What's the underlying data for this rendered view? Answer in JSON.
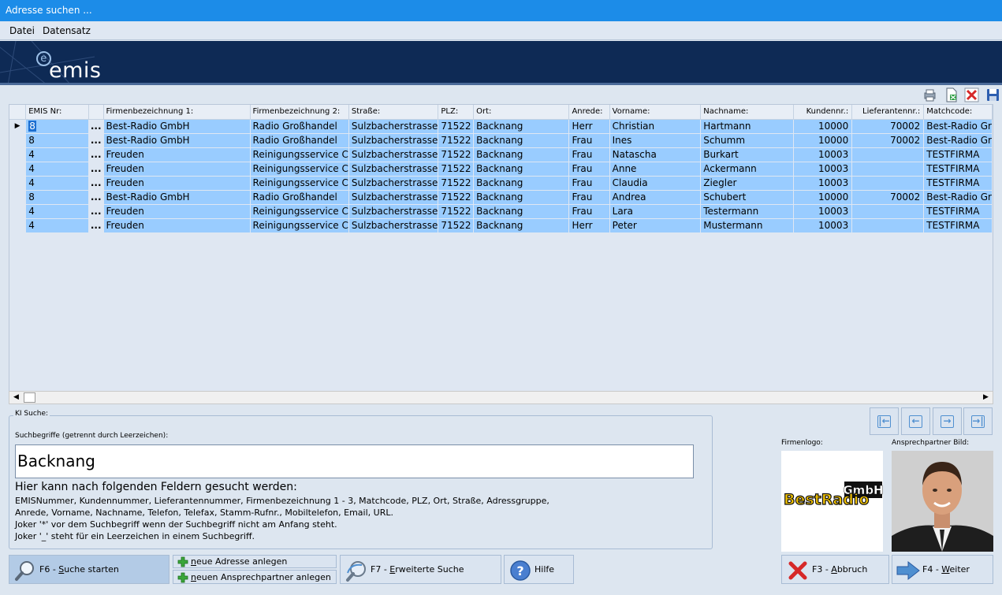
{
  "window": {
    "title": "Adresse suchen ..."
  },
  "menu": {
    "items": [
      "Datei",
      "Datensatz"
    ]
  },
  "brand": {
    "logo_text": "emis"
  },
  "toolbar": {
    "icons": [
      "print-icon",
      "export-icon",
      "delete-icon",
      "save-icon"
    ]
  },
  "grid": {
    "columns": [
      "EMIS Nr:",
      "",
      "Firmenbezeichnung 1:",
      "Firmenbezeichnung 2:",
      "Straße:",
      "PLZ:",
      "Ort:",
      "Anrede:",
      "Vorname:",
      "Nachname:",
      "Kundennr.:",
      "Lieferantennr.:",
      "Matchcode:"
    ],
    "rows": [
      [
        "8",
        "...",
        "Best-Radio GmbH",
        "Radio Großhandel",
        "Sulzbacherstrasse",
        "71522",
        "Backnang",
        "Herr",
        "Christian",
        "Hartmann",
        "10000",
        "70002",
        "Best-Radio Gr"
      ],
      [
        "8",
        "...",
        "Best-Radio GmbH",
        "Radio Großhandel",
        "Sulzbacherstrasse",
        "71522",
        "Backnang",
        "Frau",
        "Ines",
        "Schumm",
        "10000",
        "70002",
        "Best-Radio Gr"
      ],
      [
        "4",
        "...",
        "Freuden",
        "Reinigungsservice C",
        "Sulzbacherstrasse",
        "71522",
        "Backnang",
        "Frau",
        "Natascha",
        "Burkart",
        "10003",
        "",
        "TESTFIRMA"
      ],
      [
        "4",
        "...",
        "Freuden",
        "Reinigungsservice C",
        "Sulzbacherstrasse",
        "71522",
        "Backnang",
        "Frau",
        "Anne",
        "Ackermann",
        "10003",
        "",
        "TESTFIRMA"
      ],
      [
        "4",
        "...",
        "Freuden",
        "Reinigungsservice C",
        "Sulzbacherstrasse",
        "71522",
        "Backnang",
        "Frau",
        "Claudia",
        "Ziegler",
        "10003",
        "",
        "TESTFIRMA"
      ],
      [
        "8",
        "...",
        "Best-Radio GmbH",
        "Radio Großhandel",
        "Sulzbacherstrasse",
        "71522",
        "Backnang",
        "Frau",
        "Andrea",
        "Schubert",
        "10000",
        "70002",
        "Best-Radio Gr"
      ],
      [
        "4",
        "...",
        "Freuden",
        "Reinigungsservice C",
        "Sulzbacherstrasse",
        "71522",
        "Backnang",
        "Frau",
        "Lara",
        "Testermann",
        "10003",
        "",
        "TESTFIRMA"
      ],
      [
        "4",
        "...",
        "Freuden",
        "Reinigungsservice C",
        "Sulzbacherstrasse",
        "71522",
        "Backnang",
        "Herr",
        "Peter",
        "Mustermann",
        "10003",
        "",
        "TESTFIRMA"
      ]
    ],
    "selected_row": 0
  },
  "ki_search": {
    "legend": "KI Suche:",
    "label": "Suchbegriffe (getrennt durch Leerzeichen):",
    "value": "Backnang",
    "hint_title": "Hier kann nach folgenden Feldern gesucht werden:",
    "hint_lines": [
      "EMISNummer, Kundennummer, Lieferantennummer, Firmenbezeichnung 1 - 3, Matchcode, PLZ, Ort, Straße, Adressgruppe,",
      "Anrede, Vorname, Nachname, Telefon, Telefax, Stamm-Rufnr., Mobiltelefon, Email, URL.",
      "Joker '*' vor dem Suchbegriff wenn der Suchbegriff nicht am Anfang steht.",
      "Joker '_' steht für ein Leerzeichen in einem Suchbegriff."
    ]
  },
  "images": {
    "logo_label": "Firmenlogo:",
    "photo_label": "Ansprechpartner Bild:",
    "logo_text_main": "BestRadio",
    "logo_text_badge": "GmbH"
  },
  "buttons": {
    "search_prefix": "F6 - ",
    "search_key": "S",
    "search_rest": "uche starten",
    "new_address_key": "n",
    "new_address_rest": "eue Adresse anlegen",
    "new_contact_key": "n",
    "new_contact_rest": "euen Ansprechpartner anlegen",
    "extended_prefix": "F7 - ",
    "extended_key": "E",
    "extended_rest": "rweiterte Suche",
    "help": "Hilfe",
    "cancel_prefix": "F3 - ",
    "cancel_key": "A",
    "cancel_rest": "bbruch",
    "next_prefix": "F4 - ",
    "next_key": "W",
    "next_rest": "eiter"
  }
}
